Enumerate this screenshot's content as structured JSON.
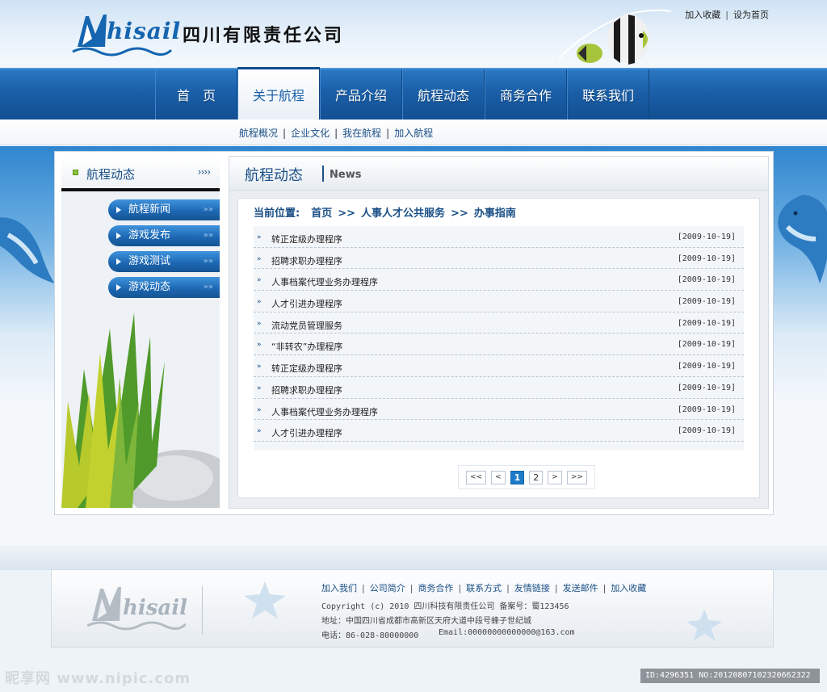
{
  "header": {
    "logo_text": "hisail",
    "company_name": "四川有限责任公司",
    "top_links": [
      "加入收藏",
      "设为首页"
    ]
  },
  "nav": {
    "items": [
      "首　页",
      "关于航程",
      "产品介绍",
      "航程动态",
      "商务合作",
      "联系我们"
    ],
    "active_index": 1
  },
  "subnav": {
    "items": [
      "航程概况",
      "企业文化",
      "我在航程",
      "加入航程"
    ]
  },
  "sidebar": {
    "title": "航程动态",
    "more": "››››",
    "menu": [
      "航程新闻",
      "游戏发布",
      "游戏测试",
      "游戏动态"
    ]
  },
  "main": {
    "title": "航程动态",
    "subtitle": "News",
    "breadcrumb": {
      "label": "当前位置:",
      "items": [
        "首页",
        "人事人才公共服务",
        "办事指南"
      ],
      "separator": ">>"
    },
    "articles": [
      {
        "title": "转正定级办理程序",
        "date": "[2009-10-19]"
      },
      {
        "title": "招聘求职办理程序",
        "date": "[2009-10-19]"
      },
      {
        "title": "人事档案代理业务办理程序",
        "date": "[2009-10-19]"
      },
      {
        "title": "人才引进办理程序",
        "date": "[2009-10-19]"
      },
      {
        "title": "流动党员管理服务",
        "date": "[2009-10-19]"
      },
      {
        "title": "“非转农”办理程序",
        "date": "[2009-10-19]"
      },
      {
        "title": "转正定级办理程序",
        "date": "[2009-10-19]"
      },
      {
        "title": "招聘求职办理程序",
        "date": "[2009-10-19]"
      },
      {
        "title": "人事档案代理业务办理程序",
        "date": "[2009-10-19]"
      },
      {
        "title": "人才引进办理程序",
        "date": "[2009-10-19]"
      }
    ],
    "pager": {
      "first": "<<",
      "prev": "<",
      "pages": [
        "1",
        "2"
      ],
      "current": "1",
      "next": ">",
      "last": ">>"
    }
  },
  "footer": {
    "logo_text": "hisail",
    "links": [
      "加入我们",
      "公司简介",
      "商务合作",
      "联系方式",
      "友情链接",
      "发送邮件",
      "加入收藏"
    ],
    "copyright": "Copyright (c) 2010 四川科技有限责任公司 备案号：蜀123456",
    "address": "地址：中国四川省成都市高新区天府大道中段号蜂子世纪城",
    "phone": "电话：86-028-80000000",
    "email": "Email:00000000000000@163.com"
  },
  "watermark": {
    "left": "昵享网 www.nipic.com",
    "right": "ID:4296351 NO:20120807102320662322"
  },
  "colors": {
    "nav_blue": "#1a5fa8",
    "text_blue": "#1a4f86",
    "accent_green": "#8cc63e",
    "pager_current": "#1d7bc9"
  }
}
